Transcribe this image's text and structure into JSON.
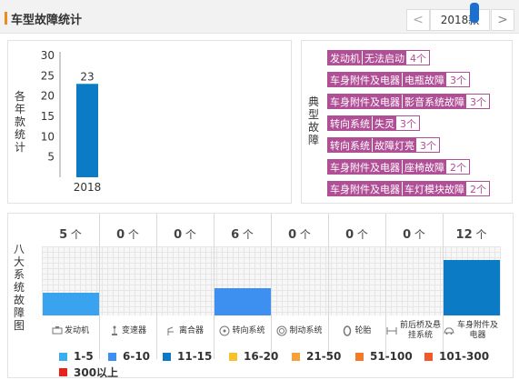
{
  "header": {
    "title": "车型故障统计",
    "year": "2018款",
    "prev_glyph": "<",
    "next_glyph": ">"
  },
  "left_panel": {
    "vertical_label": "各年款统计"
  },
  "chart_data": {
    "type": "bar",
    "categories": [
      "2018"
    ],
    "values": [
      23
    ],
    "ylim": [
      0,
      30
    ],
    "yticks": [
      5,
      10,
      15,
      20,
      25,
      30
    ],
    "data_labels": [
      "23"
    ],
    "bar_color": "#0a7bc4",
    "grid": false
  },
  "right_panel": {
    "vertical_label": "典型故障",
    "faults": [
      {
        "system": "发动机",
        "issue": "无法启动",
        "count": "4个"
      },
      {
        "system": "车身附件及电器",
        "issue": "电瓶故障",
        "count": "3个"
      },
      {
        "system": "车身附件及电器",
        "issue": "影音系统故障",
        "count": "3个"
      },
      {
        "system": "转向系统",
        "issue": "失灵",
        "count": "3个"
      },
      {
        "system": "转向系统",
        "issue": "故障灯亮",
        "count": "3个"
      },
      {
        "system": "车身附件及电器",
        "issue": "座椅故障",
        "count": "2个"
      },
      {
        "system": "车身附件及电器",
        "issue": "车灯模块故障",
        "count": "2个"
      }
    ]
  },
  "bottom_panel": {
    "vertical_label": "八大系统故障图",
    "unit": "个",
    "systems": [
      {
        "name": "发动机",
        "count": "5",
        "value": 5,
        "color": "#3aa3f0",
        "icon": "engine-icon"
      },
      {
        "name": "变速器",
        "count": "0",
        "value": 0,
        "color": "#3aa3f0",
        "icon": "gear-shift-icon"
      },
      {
        "name": "离合器",
        "count": "0",
        "value": 0,
        "color": "#3aa3f0",
        "icon": "clutch-icon"
      },
      {
        "name": "转向系统",
        "count": "6",
        "value": 6,
        "color": "#3e90f0",
        "icon": "steering-wheel-icon"
      },
      {
        "name": "制动系统",
        "count": "0",
        "value": 0,
        "color": "#3aa3f0",
        "icon": "brake-icon"
      },
      {
        "name": "轮胎",
        "count": "0",
        "value": 0,
        "color": "#3aa3f0",
        "icon": "tire-icon"
      },
      {
        "name": "前后桥及悬挂系统",
        "count": "0",
        "value": 0,
        "color": "#3aa3f0",
        "icon": "suspension-icon"
      },
      {
        "name": "车身附件及电器",
        "count": "12",
        "value": 12,
        "color": "#0a7bc4",
        "icon": "car-body-icon"
      }
    ],
    "legend": [
      {
        "label": "1-5",
        "color": "#3aaeef"
      },
      {
        "label": "6-10",
        "color": "#3e90f0"
      },
      {
        "label": "11-15",
        "color": "#0a7bc4"
      },
      {
        "label": "16-20",
        "color": "#f6c12d"
      },
      {
        "label": "21-50",
        "color": "#f6a23b"
      },
      {
        "label": "51-100",
        "color": "#f37a2a"
      },
      {
        "label": "101-300",
        "color": "#f05a28"
      },
      {
        "label": "300以上",
        "color": "#e8221b"
      }
    ]
  }
}
